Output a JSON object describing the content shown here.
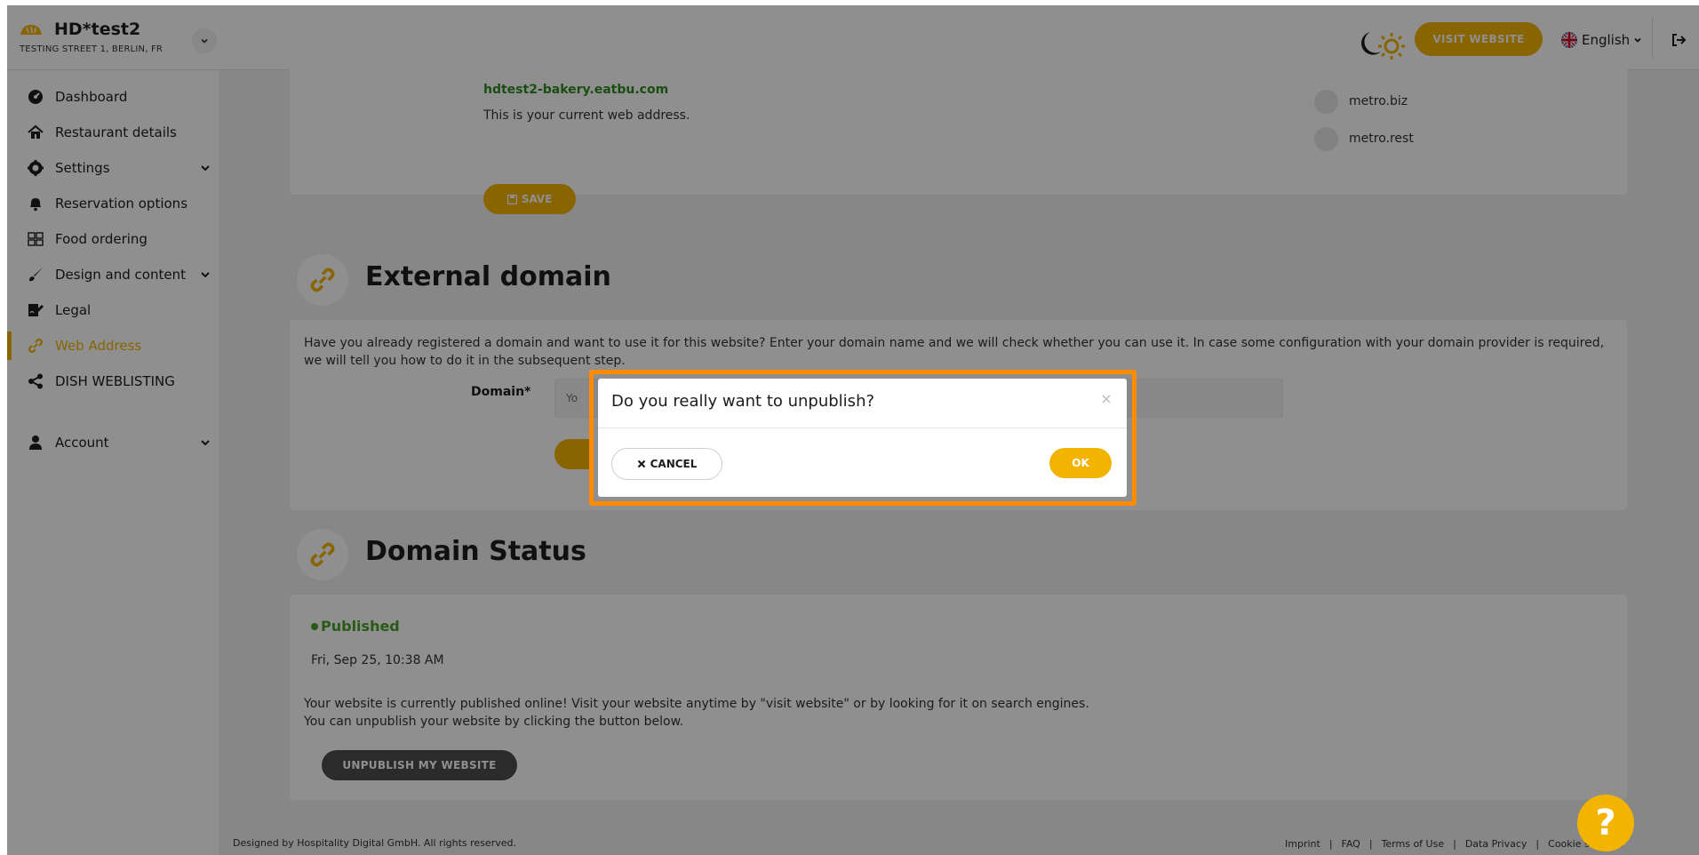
{
  "brand": {
    "name": "HD*test2",
    "address": "TESTING STREET 1, BERLIN, FR"
  },
  "header": {
    "visit_website": "VISIT WEBSITE",
    "language": "English"
  },
  "sidebar": {
    "items": [
      {
        "label": "Dashboard"
      },
      {
        "label": "Restaurant details"
      },
      {
        "label": "Settings"
      },
      {
        "label": "Reservation options"
      },
      {
        "label": "Food ordering"
      },
      {
        "label": "Design and content"
      },
      {
        "label": "Legal"
      },
      {
        "label": "Web Address"
      },
      {
        "label": "DISH WEBLISTING"
      },
      {
        "label": "Account"
      }
    ]
  },
  "web_address": {
    "address": "hdtest2-bakery.eatbu.com",
    "help": "This is your current web address.",
    "options": [
      "metro.biz",
      "metro.rest"
    ],
    "save_label": "SAVE"
  },
  "external_domain": {
    "title": "External domain",
    "description": "Have you already registered a domain and want to use it for this website? Enter your domain name and we will check whether you can use it. In case some configuration with your domain provider is required, we will tell you how to do it in the subsequent step.",
    "domain_label": "Domain*",
    "domain_placeholder": "Yo"
  },
  "domain_status": {
    "title": "Domain Status",
    "status": "Published",
    "date": "Fri, Sep 25, 10:38 AM",
    "line1": "Your website is currently published online! Visit your website anytime by \"visit website\" or by looking for it on search engines.",
    "line2": "You can unpublish your website by clicking the button below.",
    "unpublish_label": "UNPUBLISH MY WEBSITE"
  },
  "footer": {
    "copyright": "Designed by Hospitality Digital GmbH. All rights reserved.",
    "links": [
      "Imprint",
      "FAQ",
      "Terms of Use",
      "Data Privacy",
      "Cookie settings"
    ]
  },
  "modal": {
    "title": "Do you really want to unpublish?",
    "cancel_label": "CANCEL",
    "ok_label": "OK"
  },
  "help": {
    "label": "?"
  },
  "colors": {
    "accent": "#f2b400",
    "highlight": "#ff8c00",
    "published": "#4aa12a"
  }
}
